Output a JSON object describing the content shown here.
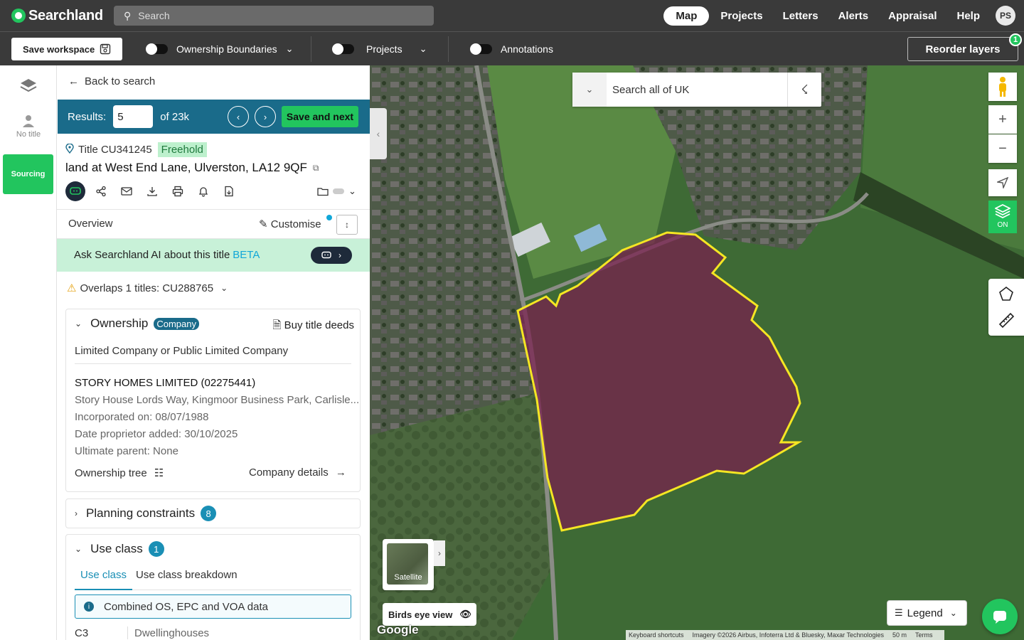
{
  "app": {
    "logo": "Searchland",
    "search_placeholder": "Search",
    "nav": [
      "Map",
      "Projects",
      "Letters",
      "Alerts",
      "Appraisal",
      "Help"
    ],
    "avatar": "PS"
  },
  "toolbar": {
    "save_workspace": "Save workspace",
    "ownership_boundaries": "Ownership Boundaries",
    "projects": "Projects",
    "annotations": "Annotations",
    "reorder_layers": "Reorder layers",
    "reorder_badge": "1"
  },
  "rail": {
    "no_title": "No title",
    "sourcing": "Sourcing"
  },
  "panel": {
    "back": "Back to search",
    "results_label": "Results:",
    "results_value": "5",
    "results_of": "of 23k",
    "save_next": "Save and next",
    "title_number": "Title CU341245",
    "tenure": "Freehold",
    "address": "land at West End Lane, Ulverston, LA12 9QF",
    "overview": "Overview",
    "customise": "Customise",
    "ai_prompt": "Ask Searchland AI about this title",
    "ai_beta": "BETA",
    "overlaps": "Overlaps 1 titles: CU288765"
  },
  "ownership": {
    "heading": "Ownership",
    "tag": "Company",
    "buy": "Buy title deeds",
    "type": "Limited Company or Public Limited Company",
    "company": "STORY HOMES LIMITED (02275441)",
    "address": "Story House Lords Way, Kingmoor Business Park, Carlisle...",
    "incorporated": "Incorporated on: 08/07/1988",
    "date_added": "Date proprietor added: 30/10/2025",
    "parent": "Ultimate parent:  None",
    "tree": "Ownership tree",
    "details": "Company details"
  },
  "planning": {
    "heading": "Planning constraints",
    "count": "8"
  },
  "use_class": {
    "heading": "Use class",
    "count": "1",
    "tabs": [
      "Use class",
      "Use class breakdown"
    ],
    "info": "Combined OS, EPC and VOA data",
    "row_code": "C3",
    "row_name": "Dwellinghouses"
  },
  "map": {
    "search": "Search all of UK",
    "layers_on": "ON",
    "satellite": "Satellite",
    "birds_eye": "Birds eye view",
    "google": "Google",
    "legend": "Legend",
    "attribution": [
      "Keyboard shortcuts",
      "Imagery ©2026 Airbus, Infoterra Ltd & Bluesky, Maxar Technologies",
      "50 m",
      "Terms"
    ],
    "boundary_color": "#f5e623",
    "fill_color": "#7a1f4f"
  }
}
